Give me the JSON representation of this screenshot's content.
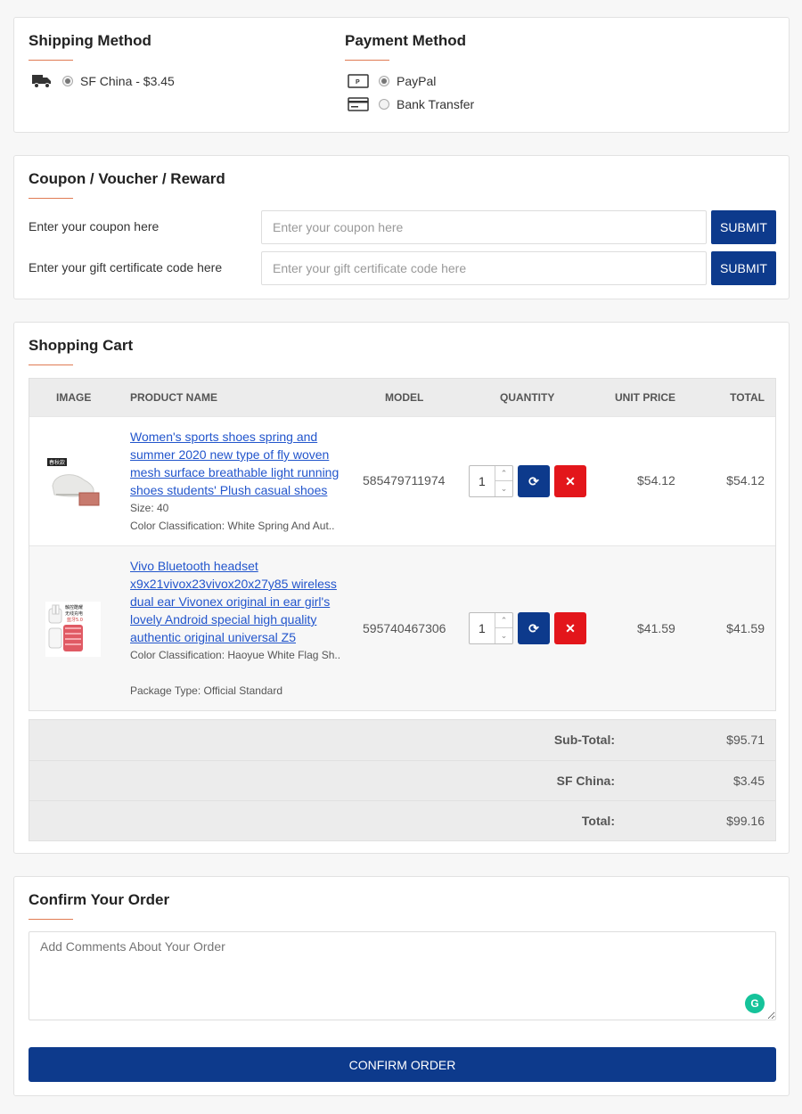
{
  "shipping": {
    "title": "Shipping Method",
    "icon": "delivery-truck-icon",
    "option_label": "SF China - $3.45",
    "selected": true
  },
  "payment": {
    "title": "Payment Method",
    "options": [
      {
        "label": "PayPal",
        "icon": "paypal-card-icon",
        "selected": true
      },
      {
        "label": "Bank Transfer",
        "icon": "credit-card-icon",
        "selected": false
      }
    ]
  },
  "coupon": {
    "title": "Coupon / Voucher / Reward",
    "coupon_label": "Enter your coupon here",
    "coupon_placeholder": "Enter your coupon here",
    "gift_label": "Enter your gift certificate code here",
    "gift_placeholder": "Enter your gift certificate code here",
    "submit_label": "SUBMIT"
  },
  "cart": {
    "title": "Shopping Cart",
    "headers": [
      "IMAGE",
      "PRODUCT NAME",
      "MODEL",
      "QUANTITY",
      "UNIT PRICE",
      "TOTAL"
    ],
    "items": [
      {
        "name": "Women's sports shoes spring and summer 2020 new type of fly woven mesh surface breathable light running shoes students' Plush casual shoes",
        "meta": [
          "Size: 40",
          "Color Classification: White Spring And Aut.."
        ],
        "model": "585479711974",
        "quantity": "1",
        "unit_price": "$54.12",
        "total": "$54.12",
        "image_badge": "春秋款"
      },
      {
        "name": "Vivo Bluetooth headset x9x21vivox23vivox20x27y85 wireless dual ear Vivonex original in ear girl's lovely Android special high quality authentic original universal Z5",
        "meta": [
          "Color Classification: Haoyue White Flag Sh..",
          "Package Type: Official Standard"
        ],
        "model": "595740467306",
        "quantity": "1",
        "unit_price": "$41.59",
        "total": "$41.59",
        "image_text": "触控酷耀 无线充电 蓝牙5.0"
      }
    ],
    "totals": [
      {
        "label": "Sub-Total:",
        "value": "$95.71"
      },
      {
        "label": "SF China:",
        "value": "$3.45"
      },
      {
        "label": "Total:",
        "value": "$99.16"
      }
    ]
  },
  "confirm": {
    "title": "Confirm Your Order",
    "comment_placeholder": "Add Comments About Your Order",
    "button_label": "CONFIRM ORDER"
  }
}
